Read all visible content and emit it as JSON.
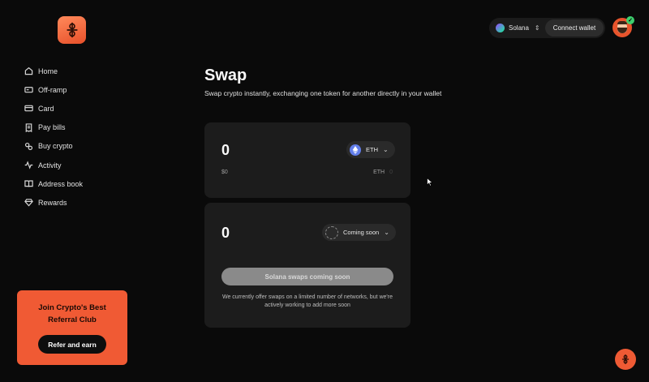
{
  "sidebar": {
    "items": [
      {
        "label": "Home",
        "icon": "home-icon"
      },
      {
        "label": "Off-ramp",
        "icon": "off-ramp-icon"
      },
      {
        "label": "Card",
        "icon": "card-icon"
      },
      {
        "label": "Pay bills",
        "icon": "bill-icon"
      },
      {
        "label": "Buy crypto",
        "icon": "buy-crypto-icon"
      },
      {
        "label": "Activity",
        "icon": "activity-icon"
      },
      {
        "label": "Address book",
        "icon": "book-icon"
      },
      {
        "label": "Rewards",
        "icon": "diamond-icon"
      }
    ],
    "promo": {
      "title": "Join Crypto's Best Referral Club",
      "button_label": "Refer and earn"
    }
  },
  "header": {
    "chain_label": "Solana",
    "connect_label": "Connect wallet"
  },
  "main": {
    "title": "Swap",
    "subtitle": "Swap crypto instantly, exchanging one token for another directly in your wallet",
    "from": {
      "amount": "0",
      "token": "ETH",
      "usd_value": "$0",
      "balance_token": "ETH",
      "balance_value": "0"
    },
    "to": {
      "amount": "0",
      "token": "Coming soon"
    },
    "swap_button_label": "Solana swaps coming soon",
    "note": "We currently offer swaps on a limited number of networks, but we're actively working to add more soon"
  },
  "colors": {
    "accent": "#f05a34",
    "background": "#0a0a0a",
    "card": "#1c1c1c",
    "eth": "#627eea"
  }
}
